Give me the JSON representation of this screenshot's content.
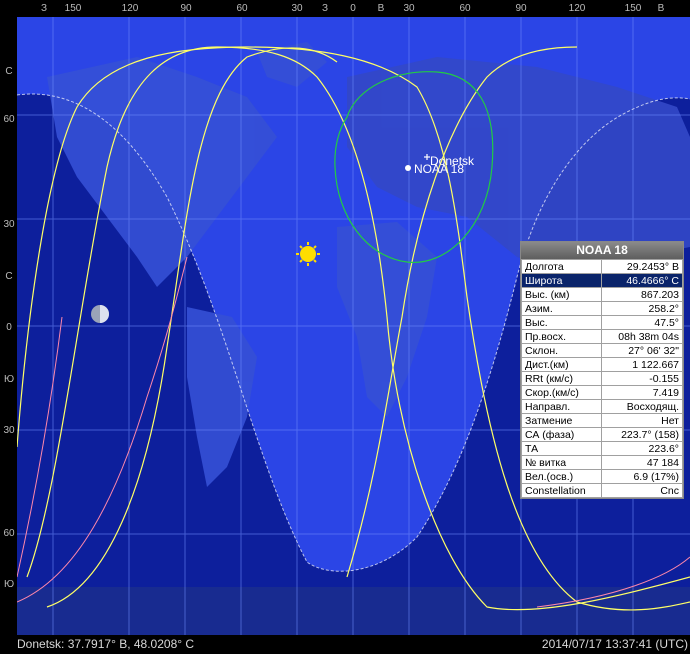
{
  "top_ticks": [
    "З",
    "150",
    "120",
    "90",
    "60",
    "30",
    "З",
    "0",
    "В",
    "30",
    "60",
    "90",
    "120",
    "150",
    "В"
  ],
  "left_ticks": [
    "С",
    "60",
    "30",
    "С",
    "0",
    "Ю",
    "30",
    "60",
    "Ю"
  ],
  "observer_label": "Donetsk",
  "satellite_label": "NOAA 18",
  "status": {
    "location": "Donetsk: 37.7917° В, 48.0208° С",
    "datetime": "2014/07/17 13:37:41 (UTC)"
  },
  "panel": {
    "title": "NOAA 18",
    "selected_row": 1,
    "rows": [
      {
        "label": "Долгота",
        "value": "29.2453° В"
      },
      {
        "label": "Широта",
        "value": "46.4666° С"
      },
      {
        "label": "Выс. (км)",
        "value": "867.203"
      },
      {
        "label": "Азим.",
        "value": "258.2°"
      },
      {
        "label": "Выс.",
        "value": "47.5°"
      },
      {
        "label": "Пр.восх.",
        "value": "08h 38m 04s"
      },
      {
        "label": "Склон.",
        "value": "27° 06' 32\""
      },
      {
        "label": "Дист.(км)",
        "value": "1 122.667"
      },
      {
        "label": "RRt (км/с)",
        "value": "-0.155"
      },
      {
        "label": "Скор.(км/с)",
        "value": "7.419"
      },
      {
        "label": "Направл.",
        "value": "Восходящ."
      },
      {
        "label": "Затмение",
        "value": "Нет"
      },
      {
        "label": "СА (фаза)",
        "value": "223.7° (158)"
      },
      {
        "label": "ТА",
        "value": "223.6°"
      },
      {
        "label": "№ витка",
        "value": "47 184"
      },
      {
        "label": "Вел.(осв.)",
        "value": "6.9 (17%)"
      },
      {
        "label": "Constellation",
        "value": "Cnc"
      }
    ]
  },
  "colors": {
    "night": "#0d1f9c",
    "day": "#2b45e6",
    "land_night": "#16287a",
    "land_day": "#3550d6",
    "track": "#ffff66",
    "footprint": "#22cc44",
    "grid": "#6f8cff",
    "terminator": "#ff6688"
  },
  "icons": {
    "sun": "sun-icon",
    "moon": "moon-icon",
    "satellite": "satellite-marker-icon",
    "observer": "observer-cross-icon"
  }
}
